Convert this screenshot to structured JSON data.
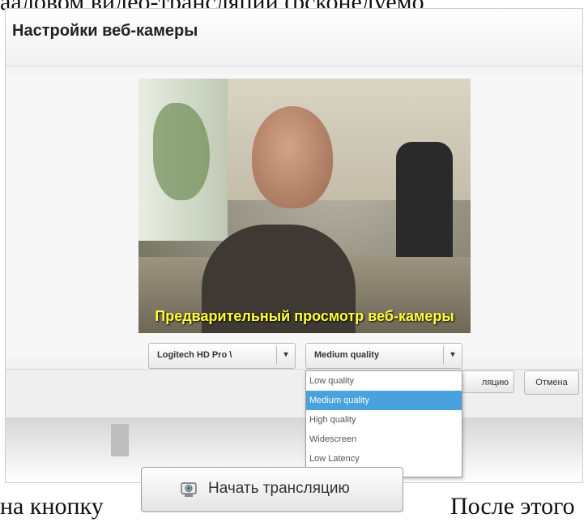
{
  "doc": {
    "top_text": "ааловом видео-трансляций (рсконедуемо",
    "text_before": "на кнопку",
    "text_after": "После этого"
  },
  "dialog": {
    "title": "Настройки веб-камеры",
    "preview_caption": "Предварительный просмотр веб-камеры",
    "camera_select": {
      "value": "Logitech HD Pro \\",
      "arrow": "▾"
    },
    "quality_select": {
      "value": "Medium quality",
      "arrow": "▾"
    },
    "quality_options": [
      "Low quality",
      "Medium quality",
      "High quality",
      "Widescreen",
      "Low Latency"
    ],
    "selected_option_index": 1,
    "start_button_partial": "ляцию",
    "cancel_button": "Отмена"
  },
  "start_button": {
    "label": "Начать трансляцию",
    "icon": "webcam-icon"
  }
}
